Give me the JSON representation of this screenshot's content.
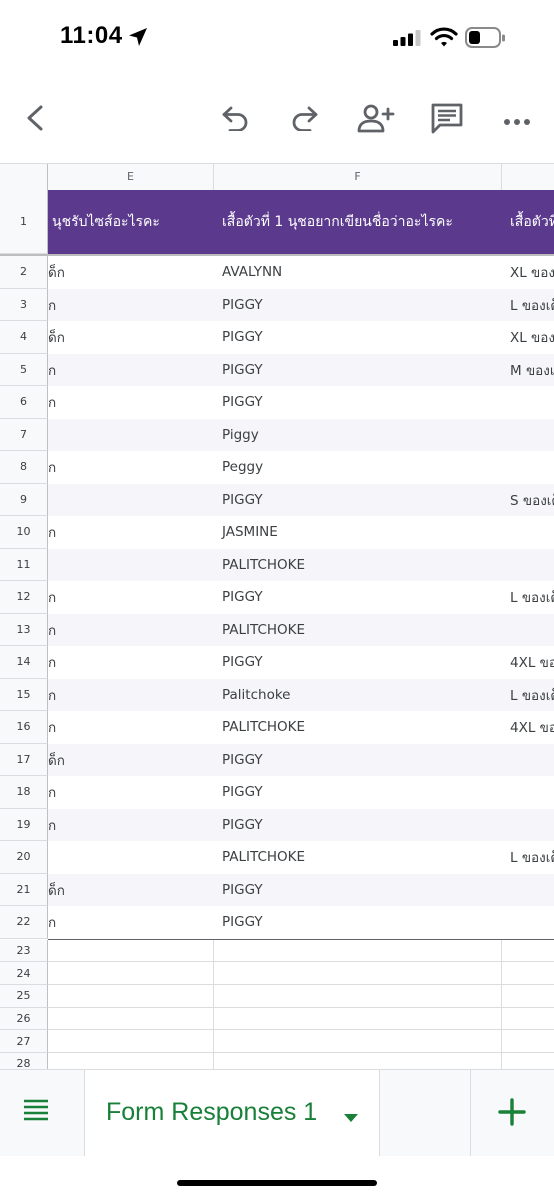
{
  "status_bar": {
    "time": "11:04"
  },
  "toolbar": {
    "back_icon": "chevron-left-icon",
    "undo_icon": "undo-icon",
    "redo_icon": "redo-icon",
    "share_icon": "add-person-icon",
    "comment_icon": "comment-icon",
    "more_icon": "more-horizontal-icon"
  },
  "columns": [
    "E",
    "F"
  ],
  "header_row": {
    "num": "1",
    "e": "นุชรับไซส์อะไรคะ",
    "f": "เสื้อตัวที่ 1 นุชอยากเขียนชื่อว่าอะไรคะ",
    "g": "เสื้อตัวที่"
  },
  "rows": [
    {
      "num": "2",
      "e": "ด็ก",
      "f": "AVALYNN",
      "g": "XL ของเ"
    },
    {
      "num": "3",
      "e": "ก",
      "f": "PIGGY",
      "g": "L ของเด็"
    },
    {
      "num": "4",
      "e": "ด็ก",
      "f": "PIGGY",
      "g": "XL ของเ"
    },
    {
      "num": "5",
      "e": "ก",
      "f": "PIGGY",
      "g": "M ของเด"
    },
    {
      "num": "6",
      "e": "ก",
      "f": "PIGGY",
      "g": ""
    },
    {
      "num": "7",
      "e": "",
      "f": "Piggy",
      "g": ""
    },
    {
      "num": "8",
      "e": "ก",
      "f": "Peggy",
      "g": ""
    },
    {
      "num": "9",
      "e": "",
      "f": "PIGGY",
      "g": "S ของเด็"
    },
    {
      "num": "10",
      "e": "ก",
      "f": "JASMINE",
      "g": ""
    },
    {
      "num": "11",
      "e": "",
      "f": "PALITCHOKE",
      "g": ""
    },
    {
      "num": "12",
      "e": "ก",
      "f": "PIGGY",
      "g": "L ของเด็"
    },
    {
      "num": "13",
      "e": "ก",
      "f": "PALITCHOKE",
      "g": ""
    },
    {
      "num": "14",
      "e": "ก",
      "f": "PIGGY",
      "g": "4XL ของ"
    },
    {
      "num": "15",
      "e": "ก",
      "f": "Palitchoke",
      "g": "L ของเด็"
    },
    {
      "num": "16",
      "e": "ก",
      "f": "PALITCHOKE",
      "g": "4XL ของ"
    },
    {
      "num": "17",
      "e": "ด็ก",
      "f": "PIGGY",
      "g": ""
    },
    {
      "num": "18",
      "e": "ก",
      "f": "PIGGY",
      "g": ""
    },
    {
      "num": "19",
      "e": "ก",
      "f": "PIGGY",
      "g": ""
    },
    {
      "num": "20",
      "e": "",
      "f": "PALITCHOKE",
      "g": "L ของเด็"
    },
    {
      "num": "21",
      "e": "ด็ก",
      "f": "PIGGY",
      "g": ""
    },
    {
      "num": "22",
      "e": "ก",
      "f": "PIGGY",
      "g": ""
    }
  ],
  "empty_rows": [
    "23",
    "24",
    "25",
    "26",
    "27",
    "28"
  ],
  "bottom": {
    "sheet_tab": "Form Responses 1"
  },
  "colors": {
    "header_bg": "#5b3a8e",
    "accent": "#188038"
  }
}
